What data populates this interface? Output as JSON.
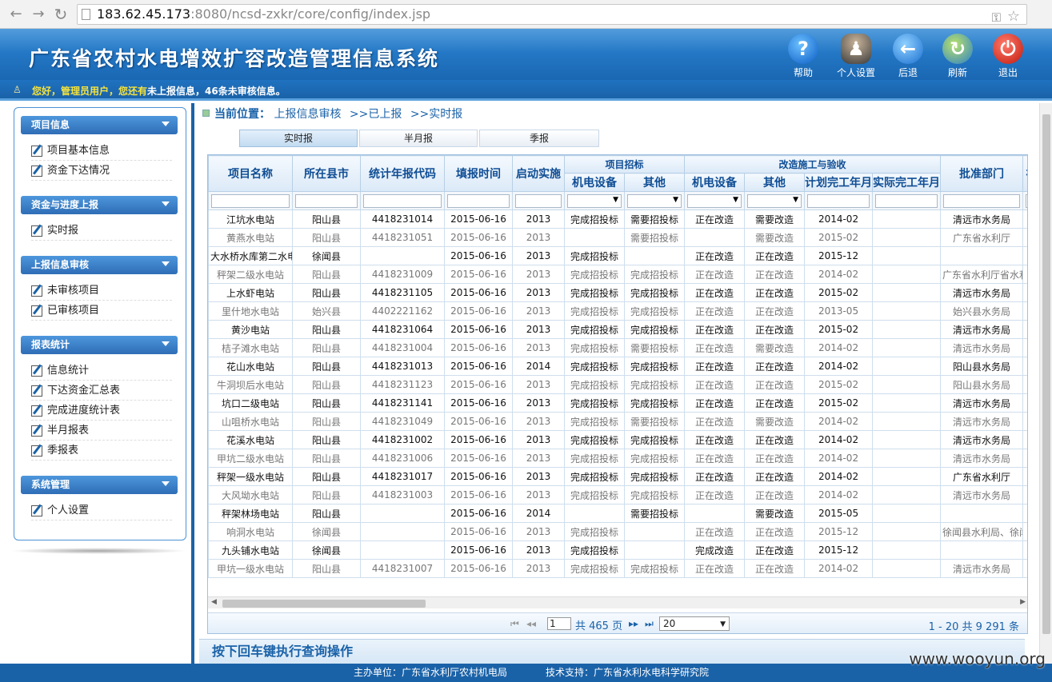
{
  "browser": {
    "url_host": "183.62.45.173",
    "url_rest": ":8080/ncsd-zxkr/core/config/index.jsp"
  },
  "header": {
    "title": "广东省农村水电增效扩容改造管理信息系统",
    "tools": [
      {
        "label": "帮助",
        "icon": "help-icon"
      },
      {
        "label": "个人设置",
        "icon": "user-settings-icon"
      },
      {
        "label": "后退",
        "icon": "back-icon"
      },
      {
        "label": "刷新",
        "icon": "refresh-icon"
      },
      {
        "label": "退出",
        "icon": "power-icon"
      }
    ],
    "welcome": "您好，管理员用户，您还有",
    "welcome_msg": "未上报信息，46条未审核信息。"
  },
  "sidebar": {
    "sections": [
      {
        "title": "项目信息",
        "items": [
          "项目基本信息",
          "资金下达情况"
        ]
      },
      {
        "title": "资金与进度上报",
        "items": [
          "实时报"
        ]
      },
      {
        "title": "上报信息审核",
        "items": [
          "未审核项目",
          "已审核项目"
        ]
      },
      {
        "title": "报表统计",
        "items": [
          "信息统计",
          "下达资金汇总表",
          "完成进度统计表",
          "半月报表",
          "季报表"
        ]
      },
      {
        "title": "系统管理",
        "items": [
          "个人设置"
        ]
      }
    ]
  },
  "breadcrumb": {
    "label": "当前位置：",
    "path": [
      "上报信息审核",
      ">>已上报",
      ">>实时报"
    ]
  },
  "tabs": [
    "实时报",
    "半月报",
    "季报"
  ],
  "table": {
    "group_headers": [
      "项目招标",
      "改造施工与验收"
    ],
    "columns": [
      "项目名称",
      "所在县市",
      "统计年报代码",
      "填报时间",
      "启动实施",
      "机电设备",
      "其他",
      "机电设备",
      "其他",
      "计划完工年月",
      "实际完工年月",
      "批准部门",
      "初"
    ],
    "rows": [
      [
        "江坑水电站",
        "阳山县",
        "4418231014",
        "2015-06-16",
        "2013",
        "完成招投标",
        "需要招投标",
        "正在改造",
        "需要改造",
        "2014-02",
        "",
        "清远市水务局",
        ""
      ],
      [
        "黄燕水电站",
        "阳山县",
        "4418231051",
        "2015-06-16",
        "2013",
        "",
        "需要招投标",
        "",
        "需要改造",
        "2015-02",
        "",
        "广东省水利厅",
        ""
      ],
      [
        "大水桥水库第二水电站",
        "徐闻县",
        "",
        "2015-06-16",
        "2013",
        "完成招投标",
        "",
        "正在改造",
        "正在改造",
        "2015-12",
        "",
        "",
        ""
      ],
      [
        "秤架二级水电站",
        "阳山县",
        "4418231009",
        "2015-06-16",
        "2013",
        "完成招投标",
        "完成招投标",
        "正在改造",
        "正在改造",
        "2014-02",
        "",
        "广东省水利厅省水利",
        ""
      ],
      [
        "上水虾电站",
        "阳山县",
        "4418231105",
        "2015-06-16",
        "2013",
        "完成招投标",
        "完成招投标",
        "正在改造",
        "正在改造",
        "2015-02",
        "",
        "清远市水务局",
        ""
      ],
      [
        "里什地水电站",
        "始兴县",
        "4402221162",
        "2015-06-16",
        "2013",
        "完成招投标",
        "完成招投标",
        "正在改造",
        "正在改造",
        "2013-05",
        "",
        "始兴县水务局",
        ""
      ],
      [
        "黄沙电站",
        "阳山县",
        "4418231064",
        "2015-06-16",
        "2013",
        "完成招投标",
        "完成招投标",
        "正在改造",
        "正在改造",
        "2015-02",
        "",
        "清远市水务局",
        ""
      ],
      [
        "桔子滩水电站",
        "阳山县",
        "4418231004",
        "2015-06-16",
        "2013",
        "完成招投标",
        "需要招投标",
        "正在改造",
        "需要改造",
        "2014-02",
        "",
        "清远市水务局",
        ""
      ],
      [
        "花山水电站",
        "阳山县",
        "4418231013",
        "2015-06-16",
        "2014",
        "完成招投标",
        "完成招投标",
        "正在改造",
        "正在改造",
        "2014-02",
        "",
        "阳山县水务局",
        ""
      ],
      [
        "牛洞坝后水电站",
        "阳山县",
        "4418231123",
        "2015-06-16",
        "2013",
        "完成招投标",
        "完成招投标",
        "正在改造",
        "正在改造",
        "2015-02",
        "",
        "阳山县水务局",
        ""
      ],
      [
        "坑口二级电站",
        "阳山县",
        "4418231141",
        "2015-06-16",
        "2013",
        "完成招投标",
        "完成招投标",
        "正在改造",
        "正在改造",
        "2015-02",
        "",
        "清远市水务局",
        ""
      ],
      [
        "山咀桥水电站",
        "阳山县",
        "4418231049",
        "2015-06-16",
        "2013",
        "完成招投标",
        "需要招投标",
        "正在改造",
        "需要改造",
        "2014-02",
        "",
        "清远市水务局",
        ""
      ],
      [
        "花溪水电站",
        "阳山县",
        "4418231002",
        "2015-06-16",
        "2013",
        "完成招投标",
        "完成招投标",
        "正在改造",
        "正在改造",
        "2014-02",
        "",
        "清远市水务局",
        ""
      ],
      [
        "甲坑二级水电站",
        "阳山县",
        "4418231006",
        "2015-06-16",
        "2013",
        "完成招投标",
        "完成招投标",
        "正在改造",
        "正在改造",
        "2014-02",
        "",
        "清远市水务局",
        ""
      ],
      [
        "秤架一级水电站",
        "阳山县",
        "4418231017",
        "2015-06-16",
        "2013",
        "完成招投标",
        "完成招投标",
        "正在改造",
        "正在改造",
        "2014-02",
        "",
        "广东省水利厅",
        ""
      ],
      [
        "大风坳水电站",
        "阳山县",
        "4418231003",
        "2015-06-16",
        "2013",
        "完成招投标",
        "完成招投标",
        "正在改造",
        "正在改造",
        "2014-02",
        "",
        "清远市水务局",
        ""
      ],
      [
        "秤架林场电站",
        "阳山县",
        "",
        "2015-06-16",
        "2014",
        "",
        "需要招投标",
        "",
        "需要改造",
        "2015-05",
        "",
        "",
        ""
      ],
      [
        "响洞水电站",
        "徐闻县",
        "",
        "2015-06-16",
        "2013",
        "完成招投标",
        "",
        "正在改造",
        "正在改造",
        "2015-12",
        "",
        "徐闻县水利局、徐闻",
        ""
      ],
      [
        "九头铺水电站",
        "徐闻县",
        "",
        "2015-06-16",
        "2013",
        "完成招投标",
        "",
        "完成改造",
        "正在改造",
        "2015-12",
        "",
        "",
        ""
      ],
      [
        "甲坑一级水电站",
        "阳山县",
        "4418231007",
        "2015-06-16",
        "2013",
        "完成招投标",
        "完成招投标",
        "正在改造",
        "正在改造",
        "2014-02",
        "",
        "清远市水务局",
        ""
      ]
    ]
  },
  "pager": {
    "page": "1",
    "total_pages": "共 465 页",
    "page_size": "20",
    "info": "1 - 20  共 9 291 条"
  },
  "hint": "按下回车键执行查询操作",
  "footer": {
    "host": "主办单位：广东省水利厅农村机电局",
    "support": "技术支持：广东省水利水电科学研究院"
  },
  "watermark": "www.wooyun.org"
}
